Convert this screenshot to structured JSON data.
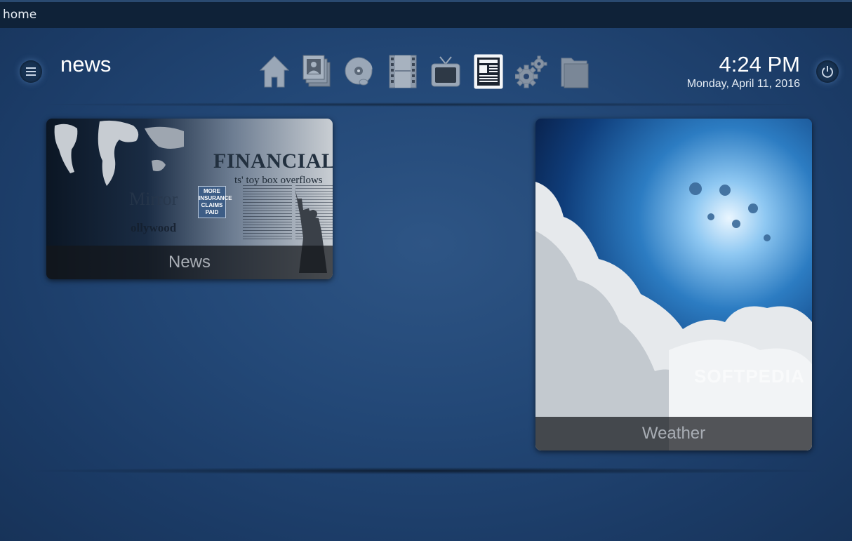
{
  "breadcrumb": "home",
  "page_title": "news",
  "clock": {
    "time": "4:24 PM",
    "date": "Monday, April 11, 2016"
  },
  "nav": [
    {
      "name": "home",
      "icon": "home-icon"
    },
    {
      "name": "pictures",
      "icon": "pictures-icon"
    },
    {
      "name": "music",
      "icon": "music-icon"
    },
    {
      "name": "videos",
      "icon": "film-icon"
    },
    {
      "name": "tv",
      "icon": "tv-icon"
    },
    {
      "name": "news",
      "icon": "news-icon",
      "active": true
    },
    {
      "name": "settings",
      "icon": "gears-icon"
    },
    {
      "name": "files",
      "icon": "folder-icon"
    }
  ],
  "tiles": {
    "news": {
      "label": "News",
      "paper_title": "FINANCIAL",
      "paper_subtitle": "ts' toy box overflows",
      "paper_mirror": "Mirror",
      "paper_hollywood": "ollywood",
      "paper_badge": "MORE INSURANCE CLAIMS PAID"
    },
    "weather": {
      "label": "Weather"
    }
  },
  "watermark": "SOFTPEDIA",
  "colors": {
    "background": "#234877",
    "topbar": "#0f2238",
    "label_bar": "#14161a"
  }
}
